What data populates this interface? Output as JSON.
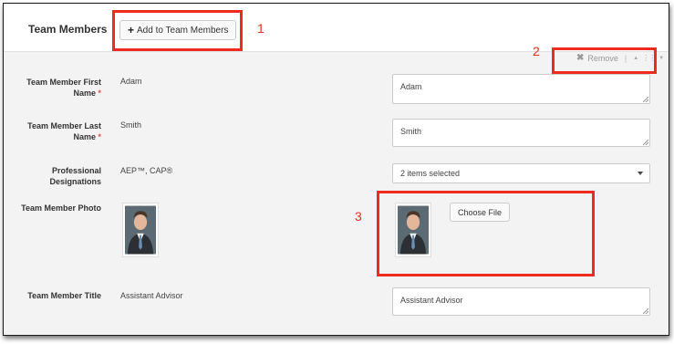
{
  "section": {
    "title": "Team Members",
    "add_button_label": "Add to Team Members"
  },
  "toolbar": {
    "remove_label": "Remove",
    "icons": [
      "close-icon",
      "triangle-up-icon",
      "drag-handle-icon",
      "triangle-down-icon"
    ]
  },
  "fields": {
    "first_name": {
      "label": "Team Member First Name",
      "required_mark": "*",
      "preview_value": "Adam",
      "input_value": "Adam"
    },
    "last_name": {
      "label": "Team Member Last Name",
      "required_mark": "*",
      "preview_value": "Smith",
      "input_value": "Smith"
    },
    "designations": {
      "label": "Professional Designations",
      "preview_value": "AEP™, CAP®",
      "select_value": "2 items selected"
    },
    "photo": {
      "label": "Team Member Photo",
      "choose_file_label": "Choose File"
    },
    "title": {
      "label": "Team Member Title",
      "preview_value": "Assistant Advisor",
      "input_value": "Assistant Advisor"
    }
  },
  "annotations": {
    "one": "1",
    "two": "2",
    "three": "3"
  },
  "colors": {
    "annotation": "#ee2b1e",
    "required": "#d9534f",
    "panel_background": "#f3f3f3"
  }
}
